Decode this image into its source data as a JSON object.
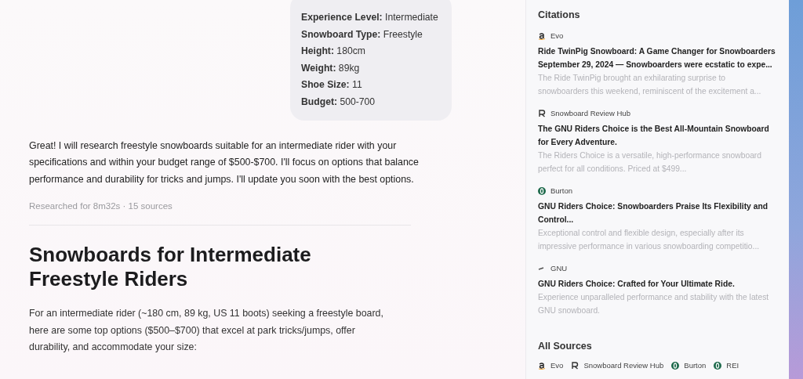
{
  "user_message": {
    "lines": [
      "**Experience Level:** Intermediate",
      "**Snowboard Type:** Freestyle",
      "**Height:** 180cm",
      "**Weight:** 89kg",
      "**Shoe Size:** 11",
      "**Budget:** 500-700"
    ]
  },
  "reply": {
    "text": "Great! I will research freestyle snowboards suitable for an intermediate rider with your specifications and within your budget range of $500-$700. I'll focus on options that balance performance and durability for tricks and jumps. I'll update you soon with the best options.",
    "meta": "Researched for 8m32s · 15 sources"
  },
  "report": {
    "heading": "Snowboards for Intermediate Freestyle Riders",
    "intro": "For an intermediate rider (~180 cm, 89 kg, US 11 boots) seeking a freestyle board, here are some top options ($500–$700) that excel at park tricks/jumps, offer durability, and accommodate your size:"
  },
  "sidebar": {
    "title": "Citations",
    "citations": [
      {
        "source": "Evo",
        "kind": "amazon",
        "title": "Ride TwinPig Snowboard: A Game Changer for Snowboarders September 29, 2024 — Snowboarders were ecstatic to expe...",
        "snippet": "The Ride TwinPig brought an exhilarating surprise to snowboarders this weekend, reminiscent of the excitement a..."
      },
      {
        "source": "Snowboard Review Hub",
        "kind": "r",
        "title": "The GNU Riders Choice is the Best All-Mountain Snowboard for Every Adventure.",
        "snippet": "The Riders Choice is a versatile, high-performance snowboard perfect for all conditions. Priced at $499..."
      },
      {
        "source": "Burton",
        "kind": "ring",
        "title": "GNU Riders Choice: Snowboarders Praise Its Flexibility and Control...",
        "snippet": "Exceptional control and flexible design, especially after its impressive performance in various snowboarding competitio..."
      },
      {
        "source": "GNU",
        "kind": "dash",
        "title": "GNU Riders Choice: Crafted for Your Ultimate Ride.",
        "snippet": "Experience unparalleled performance and stability with the latest GNU snowboard."
      }
    ],
    "all_sources_title": "All Sources",
    "all_sources": [
      {
        "name": "Evo",
        "kind": "amazon"
      },
      {
        "name": "Snowboard Review Hub",
        "kind": "r"
      },
      {
        "name": "Burton",
        "kind": "ring"
      },
      {
        "name": "REI",
        "kind": "ring"
      }
    ]
  }
}
